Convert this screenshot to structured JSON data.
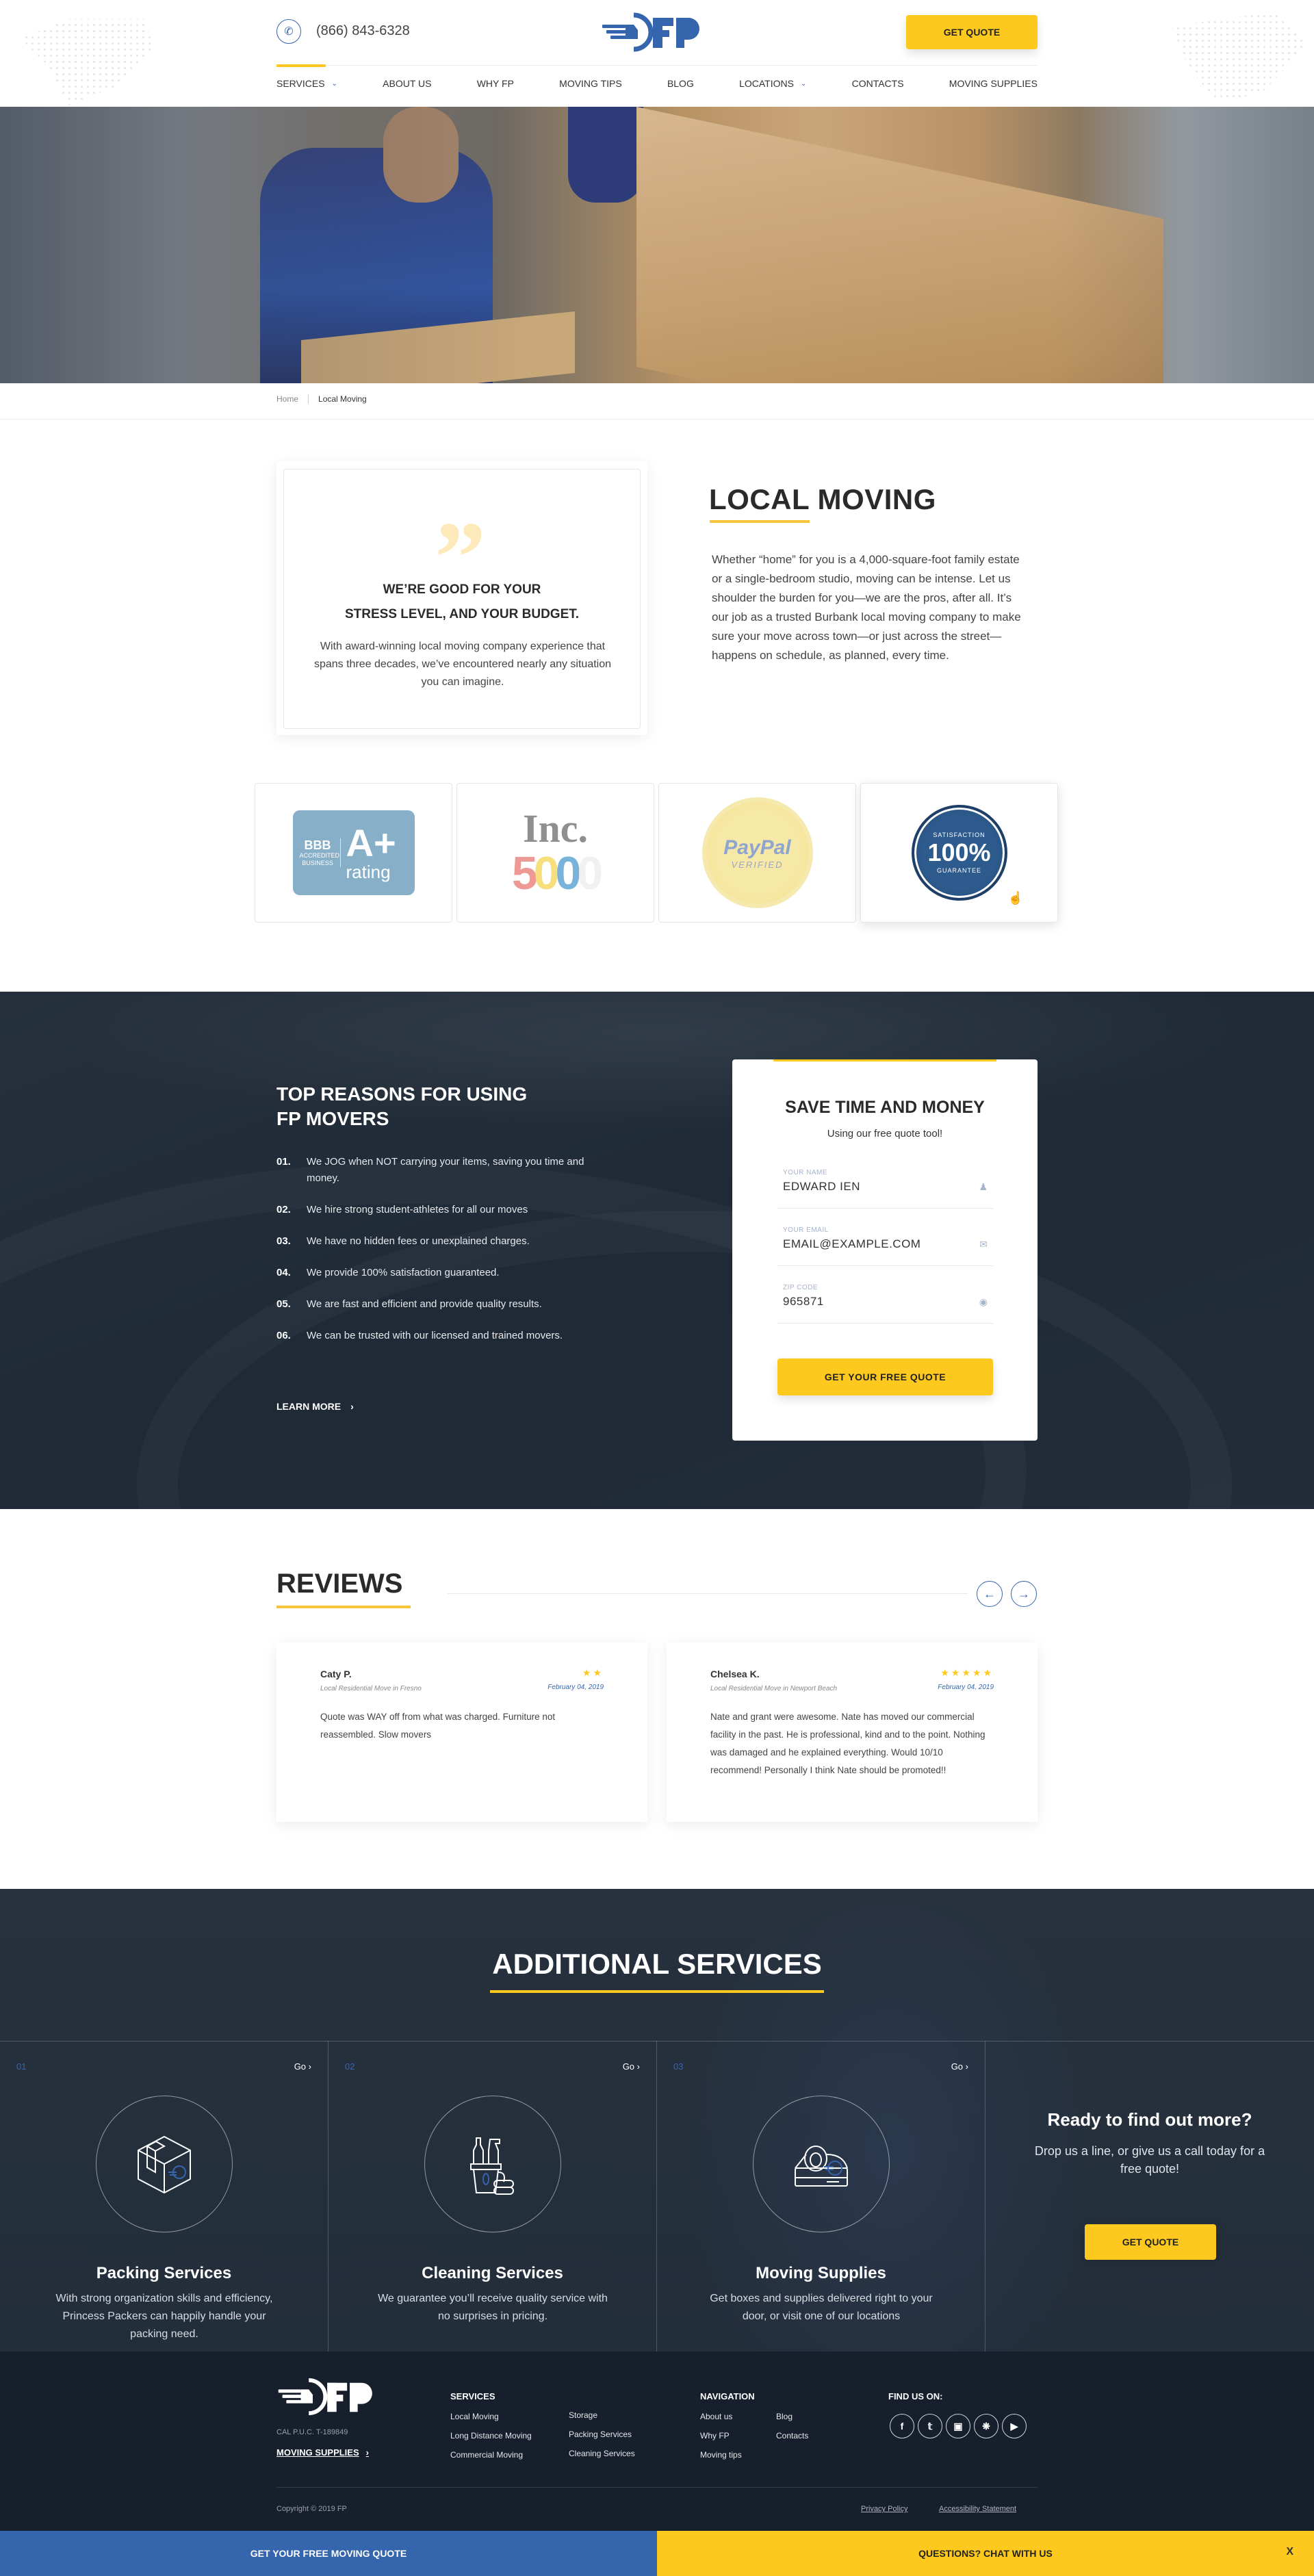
{
  "header": {
    "phone": "(866) 843-6328",
    "logo_text": "FP",
    "quote_button": "GET QUOTE",
    "nav": [
      {
        "label": "SERVICES",
        "dropdown": true,
        "active": true
      },
      {
        "label": "ABOUT US",
        "dropdown": false
      },
      {
        "label": "WHY FP",
        "dropdown": false
      },
      {
        "label": "MOVING TIPS",
        "dropdown": false
      },
      {
        "label": "BLOG",
        "dropdown": false
      },
      {
        "label": "LOCATIONS",
        "dropdown": true
      },
      {
        "label": "CONTACTS",
        "dropdown": false
      },
      {
        "label": "MOVING SUPPLIES",
        "dropdown": false
      }
    ]
  },
  "breadcrumb": {
    "home": "Home",
    "current": "Local Moving"
  },
  "intro": {
    "quote_mark": "”",
    "quote_title_1": "WE’RE GOOD FOR YOUR",
    "quote_title_2": "STRESS LEVEL, AND YOUR BUDGET.",
    "quote_text": "With award-winning local moving company experience that spans three decades, we’ve encountered nearly any situation you can imagine.",
    "title": "LOCAL MOVING",
    "body": "Whether “home” for you is a 4,000-square-foot family estate or a single-bedroom studio, moving can be intense. Let us shoulder the burden for you—we are the pros, after all. It’s our job as a trusted Burbank local moving company to make sure your move across town—or just across the street—happens on schedule, as planned, every time."
  },
  "badges": {
    "bbb": {
      "top": "BBB",
      "sub1": "ACCREDITED",
      "sub2": "BUSINESS",
      "grade": "A+",
      "rating": "rating"
    },
    "inc": {
      "title": "Inc.",
      "digits": [
        "5",
        "0",
        "0",
        "0"
      ]
    },
    "paypal": {
      "brand": "PayPal",
      "label": "VERIFIED"
    },
    "satisfaction": {
      "top": "SATISFACTION",
      "pct": "100%",
      "bottom": "GUARANTEE"
    }
  },
  "reasons": {
    "title_1": "TOP REASONS FOR USING",
    "title_2": "FP MOVERS",
    "items": [
      {
        "num": "01.",
        "text": "We JOG when NOT carrying your items, saving you time and money."
      },
      {
        "num": "02.",
        "text": "We hire strong student-athletes for all our moves"
      },
      {
        "num": "03.",
        "text": "We have no hidden fees or unexplained charges."
      },
      {
        "num": "04.",
        "text": "We provide 100% satisfaction guaranteed."
      },
      {
        "num": "05.",
        "text": "We are fast and efficient and provide quality results."
      },
      {
        "num": "06.",
        "text": "We can be trusted with our licensed and trained movers."
      }
    ],
    "learn_more": "LEARN MORE"
  },
  "quote_form": {
    "title": "SAVE TIME AND MONEY",
    "subtitle": "Using our free quote tool!",
    "fields": [
      {
        "label": "YOUR NAME",
        "value": "EDWARD IEN",
        "icon": "user-icon"
      },
      {
        "label": "YOUR EMAIL",
        "value": "EMAIL@EXAMPLE.COM",
        "icon": "mail-icon"
      },
      {
        "label": "ZIP CODE",
        "value": "965871",
        "icon": "location-pin-icon"
      }
    ],
    "submit": "GET YOUR FREE QUOTE"
  },
  "reviews": {
    "title": "REVIEWS",
    "items": [
      {
        "name": "Caty P.",
        "move": "Local Residential Move in Fresno",
        "stars": 2,
        "stars_text": "★★",
        "date": "February 04, 2019",
        "text": "Quote was WAY off from what was charged. Furniture not reassembled. Slow movers"
      },
      {
        "name": "Chelsea K.",
        "move": "Local Residential Move in Newport Beach",
        "stars": 5,
        "stars_text": "★★★★★",
        "date": "February 04, 2019",
        "text": "Nate and grant were awesome. Nate has moved our commercial facility in the past. He is professional, kind and to the point. Nothing was damaged and he explained everything. Would 10/10 recommend! Personally I think Nate should be promoted!!"
      }
    ]
  },
  "additional": {
    "title": "ADDITIONAL SERVICES",
    "go_label": "Go",
    "services": [
      {
        "num": "01",
        "name": "Packing Services",
        "desc": "With strong organization skills and efficiency, Princess Packers can happily handle your packing need."
      },
      {
        "num": "02",
        "name": "Cleaning Services",
        "desc": "We guarantee you’ll receive quality service with no surprises in pricing."
      },
      {
        "num": "03",
        "name": "Moving Supplies",
        "desc": "Get boxes and supplies delivered right to your door, or visit one of our locations"
      }
    ],
    "cta_title": "Ready to find out more?",
    "cta_text": "Drop us a line, or give us a call today for a free quote!",
    "cta_button": "GET QUOTE"
  },
  "footer": {
    "puc": "CAL P.U.C. T-189849",
    "moving_supplies": "MOVING SUPPLIES",
    "services_heading": "SERVICES",
    "services_col1": [
      "Local Moving",
      "Long Distance Moving",
      "Commercial Moving"
    ],
    "services_col2": [
      "Storage",
      "Packing Services",
      "Cleaning Services"
    ],
    "nav_heading": "NAVIGATION",
    "nav_col1": [
      "About us",
      "Why FP",
      "Moving tips"
    ],
    "nav_col2": [
      "Blog",
      "Contacts"
    ],
    "social_heading": "FIND US ON:",
    "social": [
      "facebook",
      "twitter",
      "instagram",
      "yelp",
      "youtube"
    ],
    "copyright": "Copyright © 2019 FP",
    "privacy": "Privacy Policy",
    "accessibility": "Accessibility Statement"
  },
  "bottom_bar": {
    "left": "GET YOUR FREE MOVING QUOTE",
    "right": "QUESTIONS? CHAT WITH US",
    "close": "X"
  },
  "colors": {
    "brand_blue": "#3565ad",
    "accent_yellow": "#fec91f",
    "dark": "#1f2a36"
  }
}
